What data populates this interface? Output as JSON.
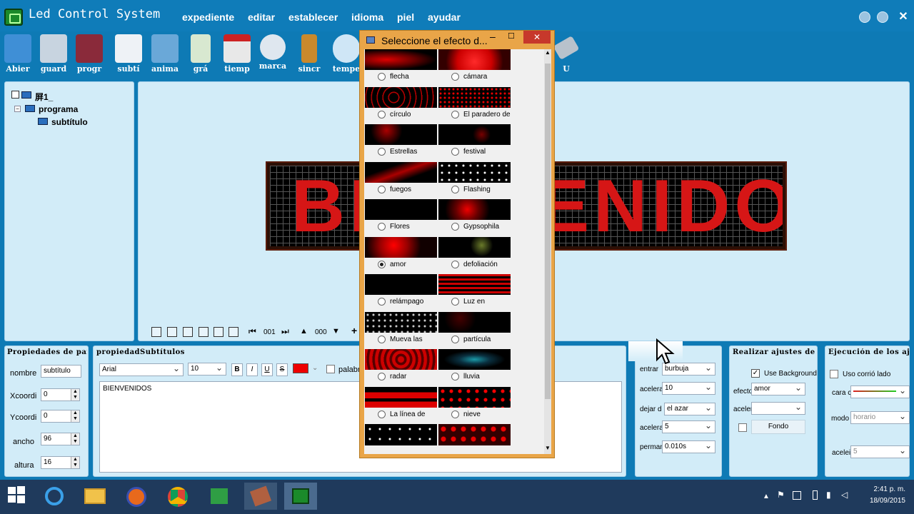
{
  "app": {
    "title": "Led Control System"
  },
  "menu": [
    "expediente",
    "editar",
    "establecer",
    "idioma",
    "piel",
    "ayudar"
  ],
  "toolbar": [
    "Abier",
    "guard",
    "progr",
    "subtí",
    "anima",
    "grá",
    "tiemp",
    "marca",
    "sincr",
    "tempe",
    "U"
  ],
  "tree": {
    "root": "屏1_",
    "program": "programa",
    "subtitle": "subtítulo"
  },
  "led": {
    "text": "BIENVENIDOS"
  },
  "nav": {
    "page": "001",
    "counter": "000"
  },
  "props": {
    "title": "Propiedades de part",
    "nombre_label": "nombre",
    "nombre": "subtítulo",
    "x_label": "Xcoordi",
    "x": "0",
    "y_label": "Ycoordi",
    "y": "0",
    "w_label": "ancho",
    "w": "96",
    "h_label": "altura",
    "h": "16"
  },
  "subs": {
    "title": "propiedadSubtítulos",
    "font": "Arial",
    "size": "10",
    "bold": "B",
    "italic": "I",
    "underline": "U",
    "strike": "S",
    "word_label": "palabra",
    "text": "BIENVENIDOS",
    "color": "#ee0000"
  },
  "effects": {
    "entrar_label": "entrar",
    "entrar": "burbuja",
    "acel_label": "acelera",
    "acel": "10",
    "dejar_label": "dejar d",
    "dejar": "el azar",
    "acel2_label": "acelera",
    "acel2": "5",
    "perm_label": "perman",
    "perm": "0.010s"
  },
  "adjust": {
    "title": "Realizar ajustes del",
    "use_bg": "Use Background",
    "efecto_label": "efecto",
    "efecto": "amor",
    "acelerar_label": "acelerar",
    "fondo": "Fondo"
  },
  "exec": {
    "title": "Ejecución de los aju",
    "uso": "Uso corrió lado",
    "cara_label": "cara c",
    "modo_label": "modo",
    "modo": "horario",
    "acel_label": "acelei",
    "acel": "5"
  },
  "dialog": {
    "title": "Seleccione el efecto d...",
    "options": [
      "flecha",
      "cámara",
      "círculo",
      "El paradero de",
      "Estrellas",
      "festival",
      "fuegos",
      "Flashing",
      "Flores",
      "Gypsophila",
      "amor",
      "defoliación",
      "relámpago",
      "Luz en",
      "Mueva las",
      "partícula",
      "radar",
      "lluvia",
      "La línea de",
      "nieve"
    ],
    "selected": "amor"
  },
  "clock": {
    "time": "2:41 p. m.",
    "date": "18/09/2015"
  }
}
